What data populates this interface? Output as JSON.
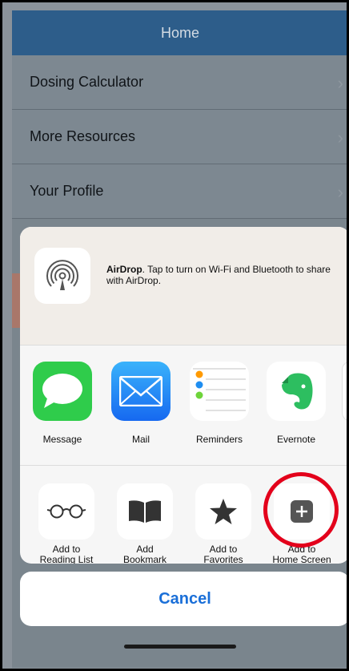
{
  "app": {
    "header_title": "Home",
    "menu": [
      {
        "label": "Dosing Calculator"
      },
      {
        "label": "More Resources"
      },
      {
        "label": "Your Profile"
      }
    ]
  },
  "share_sheet": {
    "airdrop": {
      "title": "AirDrop",
      "message": ". Tap to turn on Wi-Fi and Bluetooth to share with AirDrop."
    },
    "apps": [
      {
        "label": "Message",
        "icon": "message-icon",
        "color": "#2fcc4b"
      },
      {
        "label": "Mail",
        "icon": "mail-icon",
        "color": "#1e8ef5"
      },
      {
        "label": "Reminders",
        "icon": "reminders-icon",
        "color": "#ffffff"
      },
      {
        "label": "Evernote",
        "icon": "evernote-icon",
        "color": "#ffffff"
      }
    ],
    "actions": [
      {
        "label": "Add to\nReading List",
        "icon": "glasses-icon"
      },
      {
        "label": "Add\nBookmark",
        "icon": "book-icon"
      },
      {
        "label": "Add to\nFavorites",
        "icon": "star-icon"
      },
      {
        "label": "Add to\nHome Screen",
        "icon": "plus-square-icon"
      }
    ],
    "actions_partial_label": "D",
    "cancel_label": "Cancel"
  },
  "colors": {
    "highlight": "#e3001b",
    "accent_blue": "#1a6fd8"
  }
}
